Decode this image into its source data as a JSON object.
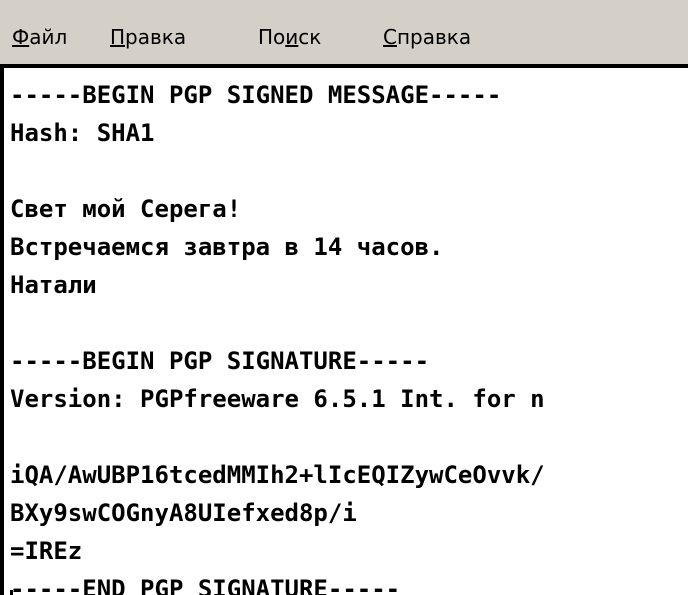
{
  "menu": {
    "items": [
      {
        "accel": "Ф",
        "rest": "айл",
        "pre": ""
      },
      {
        "accel": "П",
        "rest": "равка",
        "pre": ""
      },
      {
        "pre": "По",
        "accel": "и",
        "rest": "ск"
      },
      {
        "accel": "С",
        "rest": "правка",
        "pre": ""
      }
    ]
  },
  "document": {
    "lines": [
      "-----BEGIN PGP SIGNED MESSAGE-----",
      "Hash: SHA1",
      "",
      "Свет мой Серега!",
      "Встречаемся завтра в 14 часов.",
      "Натали",
      "",
      "-----BEGIN PGP SIGNATURE-----",
      "Version: PGPfreeware 6.5.1 Int. for n",
      "",
      "iQA/AwUBP16tcedMMIh2+lIcEQIZywCeOvvk/",
      "BXy9swCOGnyA8UIefxed8p/i",
      "=IREz",
      "-----END PGP SIGNATURE-----"
    ]
  }
}
